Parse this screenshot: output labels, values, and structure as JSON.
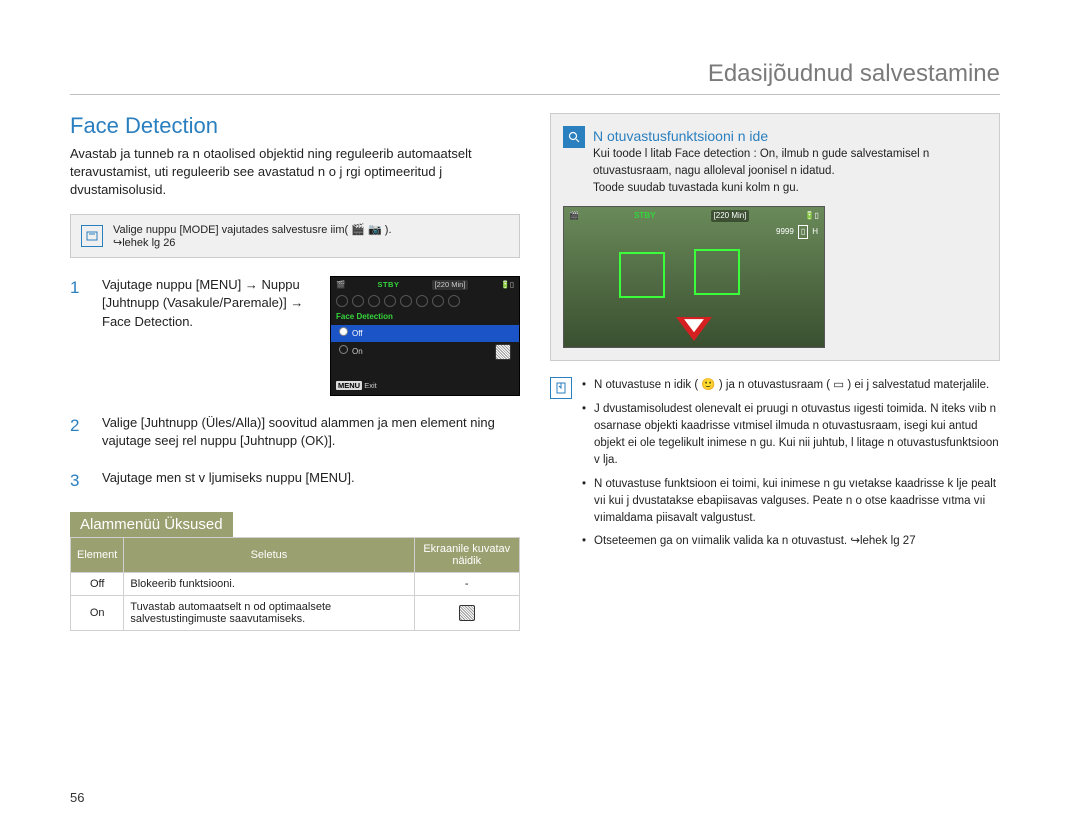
{
  "header": "Edasijõudnud salvestamine",
  "section_title": "Face Detection",
  "intro": "Avastab ja tunneb ra n otaolised objektid ning reguleerib automaatselt teravustamist, uti reguleerib see avastatud n o j rgi optimeeritud j dvustamisolusid.",
  "mode_box": {
    "line1": "Valige nuppu [MODE] vajutades salvestusre iim(",
    "line1_end": ").",
    "line2": "↪lehek lg 26"
  },
  "steps": [
    "Vajutage nuppu [MENU] → Nuppu [Juhtnupp (Vasakule/Paremale)] → Face Detection.",
    "Valige [Juhtnupp (Üles/Alla)] soovitud alammen  ja men  element ning vajutage seej rel nuppu [Juhtnupp (OK)].",
    "Vajutage men st v ljumiseks nuppu [MENU]."
  ],
  "camera_ui": {
    "stby": "STBY",
    "time": "[220 Min]",
    "fd_label": "Face Detection",
    "opt_off": "Off",
    "opt_on": "On",
    "exit_menu": "MENU",
    "exit_label": "Exit"
  },
  "submenu_title": "Alammenüü Üksused",
  "submenu_headers": [
    "Element",
    "Seletus",
    "Ekraanile kuvatav näidik"
  ],
  "submenu_rows": [
    {
      "el": "Off",
      "desc": "Blokeerib funktsiooni.",
      "disp": "-"
    },
    {
      "el": "On",
      "desc": "Tuvastab automaatselt n od optimaalsete salvestustingimuste saavutamiseks.",
      "disp": "icon"
    }
  ],
  "example": {
    "title": "N otuvastusfunktsiooni n ide",
    "p1": "Kui toode l litab Face detection : On, ilmub n gude salvestamisel n otuvastusraam, nagu alloleval joonisel n idatud.",
    "p2": "Toode suudab tuvastada kuni kolm n gu.",
    "photo": {
      "stby": "STBY",
      "time": "[220 Min]",
      "count": "9999",
      "h": "H"
    }
  },
  "notes": [
    "N otuvastuse n idik ( 🙂 ) ja n otuvastusraam ( ▭ ) ei j  salvestatud materjalile.",
    "J dvustamisoludest olenevalt ei pruugi n otuvastus ıigesti toimida. N iteks vıib n osarnase objekti kaadrisse vıtmisel ilmuda n otuvastusraam, isegi kui antud objekt ei ole tegelikult inimese n gu. Kui nii juhtub, l litage n otuvastusfunktsioon v lja.",
    "N otuvastuse funktsioon ei toimi, kui inimese n gu vıetakse kaadrisse k lje pealt vıi kui j dvustatakse ebapiisavas valguses. Peate n o otse kaadrisse vıtma vıi vıimaldama piisavalt valgustust.",
    "Otseteemen ga on vıimalik valida ka n otuvastust. ↪lehek lg 27"
  ],
  "page_number": "56"
}
